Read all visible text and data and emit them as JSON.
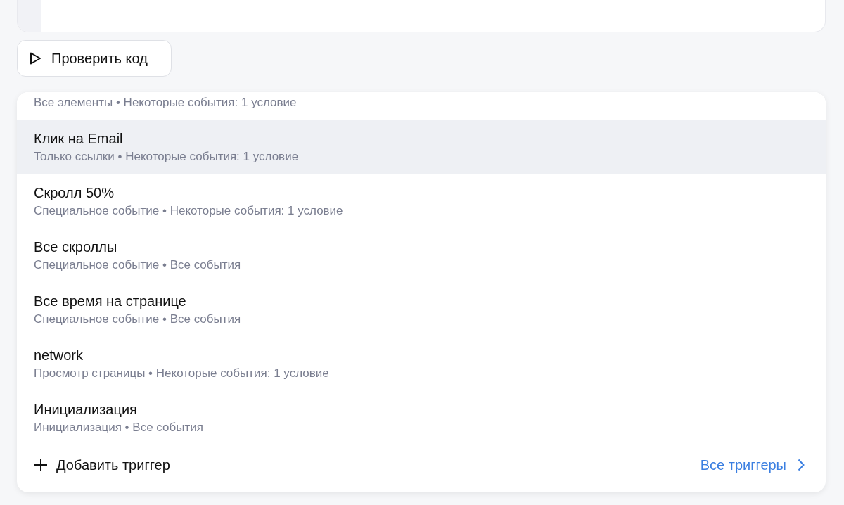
{
  "check_button": {
    "label": "Проверить код"
  },
  "triggers": [
    {
      "subtitle": "Все элементы • Некоторые события: 1 условие",
      "selected": false
    },
    {
      "title": "Клик на Email",
      "subtitle": "Только ссылки • Некоторые события: 1 условие",
      "selected": true
    },
    {
      "title": "Скролл 50%",
      "subtitle": "Специальное событие • Некоторые события: 1 условие",
      "selected": false
    },
    {
      "title": "Все скроллы",
      "subtitle": "Специальное событие • Все события",
      "selected": false
    },
    {
      "title": "Все время на странице",
      "subtitle": "Специальное событие • Все события",
      "selected": false
    },
    {
      "title": "network",
      "subtitle": "Просмотр страницы • Некоторые события: 1 условие",
      "selected": false
    },
    {
      "title": "Инициализация",
      "subtitle": "Инициализация • Все события",
      "selected": false
    }
  ],
  "footer": {
    "add_label": "Добавить триггер",
    "all_label": "Все триггеры"
  }
}
